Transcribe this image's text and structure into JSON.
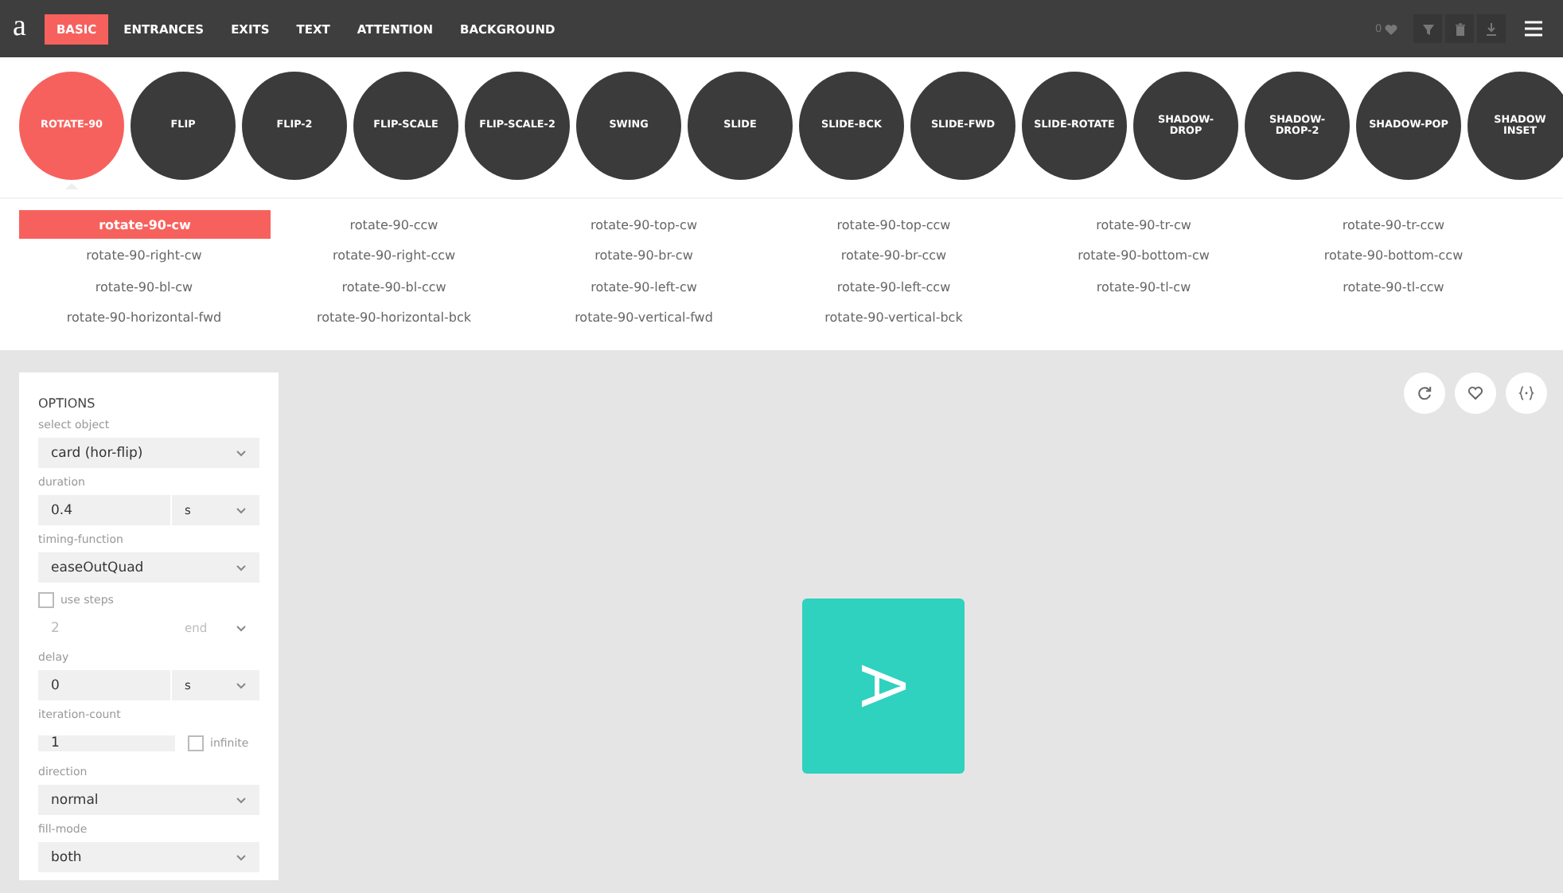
{
  "logo": "a",
  "nav_tabs": [
    {
      "label": "BASIC",
      "selected": true
    },
    {
      "label": "ENTRANCES",
      "selected": false
    },
    {
      "label": "EXITS",
      "selected": false
    },
    {
      "label": "TEXT",
      "selected": false
    },
    {
      "label": "ATTENTION",
      "selected": false
    },
    {
      "label": "BACKGROUND",
      "selected": false
    }
  ],
  "favorites_count": "0",
  "animations": [
    {
      "label": "ROTATE-90",
      "selected": true
    },
    {
      "label": "FLIP",
      "selected": false
    },
    {
      "label": "FLIP-2",
      "selected": false
    },
    {
      "label": "FLIP-SCALE",
      "selected": false
    },
    {
      "label": "FLIP-SCALE-2",
      "selected": false
    },
    {
      "label": "SWING",
      "selected": false
    },
    {
      "label": "SLIDE",
      "selected": false
    },
    {
      "label": "SLIDE-BCK",
      "selected": false
    },
    {
      "label": "SLIDE-FWD",
      "selected": false
    },
    {
      "label": "SLIDE-ROTATE",
      "selected": false
    },
    {
      "label": "SHADOW-\nDROP",
      "selected": false
    },
    {
      "label": "SHADOW-\nDROP-2",
      "selected": false
    },
    {
      "label": "SHADOW-POP",
      "selected": false
    },
    {
      "label": "SHADOW\nINSET",
      "selected": false
    }
  ],
  "variants": [
    {
      "label": "rotate-90-cw",
      "selected": true
    },
    {
      "label": "rotate-90-ccw",
      "selected": false
    },
    {
      "label": "rotate-90-top-cw",
      "selected": false
    },
    {
      "label": "rotate-90-top-ccw",
      "selected": false
    },
    {
      "label": "rotate-90-tr-cw",
      "selected": false
    },
    {
      "label": "rotate-90-tr-ccw",
      "selected": false
    },
    {
      "label": "rotate-90-right-cw",
      "selected": false
    },
    {
      "label": "rotate-90-right-ccw",
      "selected": false
    },
    {
      "label": "rotate-90-br-cw",
      "selected": false
    },
    {
      "label": "rotate-90-br-ccw",
      "selected": false
    },
    {
      "label": "rotate-90-bottom-cw",
      "selected": false
    },
    {
      "label": "rotate-90-bottom-ccw",
      "selected": false
    },
    {
      "label": "rotate-90-bl-cw",
      "selected": false
    },
    {
      "label": "rotate-90-bl-ccw",
      "selected": false
    },
    {
      "label": "rotate-90-left-cw",
      "selected": false
    },
    {
      "label": "rotate-90-left-ccw",
      "selected": false
    },
    {
      "label": "rotate-90-tl-cw",
      "selected": false
    },
    {
      "label": "rotate-90-tl-ccw",
      "selected": false
    },
    {
      "label": "rotate-90-horizontal-fwd",
      "selected": false
    },
    {
      "label": "rotate-90-horizontal-bck",
      "selected": false
    },
    {
      "label": "rotate-90-vertical-fwd",
      "selected": false
    },
    {
      "label": "rotate-90-vertical-bck",
      "selected": false
    }
  ],
  "options": {
    "title": "OPTIONS",
    "fields": [
      {
        "kind": "select",
        "label": "select object",
        "value": "card (hor-flip)"
      },
      {
        "kind": "number_unit",
        "label": "duration",
        "value": "0.4",
        "unit": "s"
      },
      {
        "kind": "select",
        "label": "timing-function",
        "value": "easeOutQuad"
      },
      {
        "kind": "checkbox",
        "label": "use steps",
        "checked": false
      },
      {
        "kind": "steps",
        "value": "2",
        "unit": "end",
        "disabled": true
      },
      {
        "kind": "number_unit",
        "label": "delay",
        "value": "0",
        "unit": "s"
      },
      {
        "kind": "number_check",
        "label": "iteration-count",
        "value": "1",
        "check_label": "infinite",
        "checked": false
      },
      {
        "kind": "select",
        "label": "direction",
        "value": "normal"
      },
      {
        "kind": "select",
        "label": "fill-mode",
        "value": "both"
      }
    ]
  },
  "preview": {
    "card_letter": "A"
  }
}
